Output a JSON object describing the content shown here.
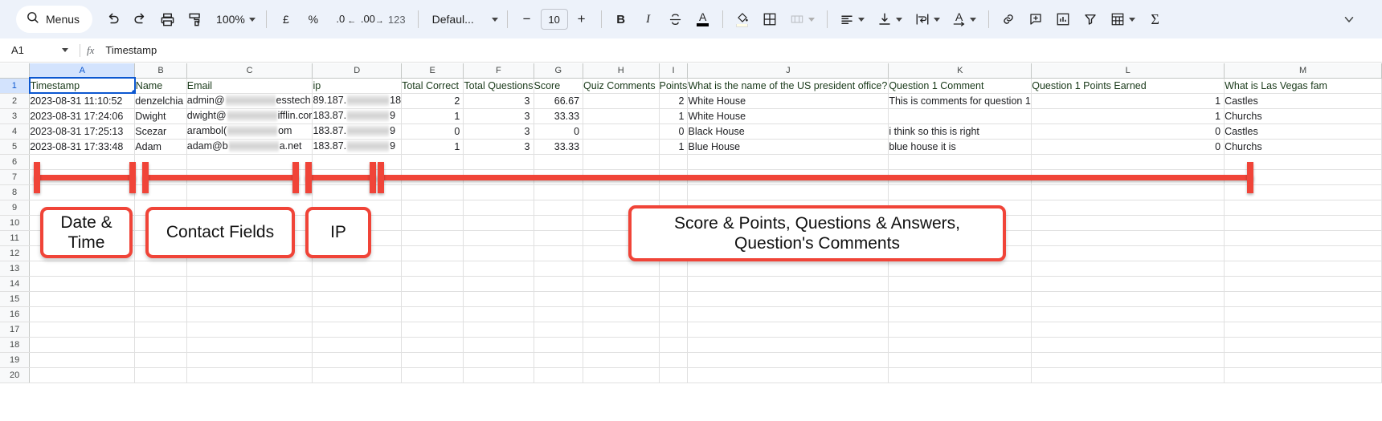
{
  "toolbar": {
    "search_label": "Menus",
    "search_icon": "search-icon",
    "undo_icon": "undo-icon",
    "redo_icon": "redo-icon",
    "print_icon": "print-icon",
    "paint_format_icon": "paint-format-icon",
    "zoom_value": "100%",
    "currency_label": "£",
    "percent_label": "%",
    "decrease_decimal_label": ".0",
    "increase_decimal_label": ".00",
    "more_formats_label": "123",
    "font_name": "Defaul...",
    "font_decrease_label": "−",
    "font_size_value": "10",
    "font_increase_label": "+",
    "bold_label": "B",
    "italic_label": "I",
    "strikethrough_icon": "strikethrough-icon",
    "text_color_label": "A",
    "fill_color_icon": "fill-color-icon",
    "borders_icon": "borders-icon",
    "merge_cells_icon": "merge-cells-icon",
    "horizontal_align_icon": "horizontal-align-icon",
    "vertical_align_icon": "vertical-align-icon",
    "text_wrap_icon": "text-wrap-icon",
    "text_rotation_label": "A",
    "link_icon": "link-icon",
    "comment_icon": "insert-comment-icon",
    "chart_icon": "insert-chart-icon",
    "filter_icon": "filter-icon",
    "functions_label": "Σ",
    "calculator_icon": "pivot-table-icon",
    "collapse_icon": "collapse-toolbar-icon"
  },
  "formula_bar": {
    "name_box": "A1",
    "fx_label": "fx",
    "content": "Timestamp"
  },
  "grid": {
    "column_letters": [
      "A",
      "B",
      "C",
      "D",
      "E",
      "F",
      "G",
      "H",
      "I",
      "J",
      "K",
      "L",
      "M"
    ],
    "selected_column": "A",
    "selected_row": "1",
    "row_numbers": [
      "1",
      "2",
      "3",
      "4",
      "5",
      "6",
      "7",
      "8",
      "9",
      "10",
      "11",
      "12",
      "13",
      "14",
      "15",
      "16",
      "17",
      "18",
      "19",
      "20"
    ],
    "headers": [
      "Timestamp",
      "Name",
      "Email",
      "ip",
      "Total Correct",
      "Total Questions",
      "Score",
      "Quiz Comments",
      "Points",
      "What is the name of the US president office?",
      "Question 1 Comment",
      "Question 1 Points Earned",
      "What is Las Vegas fam"
    ],
    "rows": [
      {
        "timestamp": "2023-08-31 11:10:52",
        "name": "denzelchia",
        "email_prefix": "admin@",
        "email_suffix": "esstech",
        "ip_prefix": "89.187.",
        "ip_suffix": "18",
        "total_correct": "2",
        "total_questions": "3",
        "score": "66.67",
        "quiz_comments": "",
        "points": "2",
        "q1_answer": "White House",
        "q1_comment": "This is comments for question 1",
        "q1_points": "1",
        "q2_answer": "Castles"
      },
      {
        "timestamp": "2023-08-31 17:24:06",
        "name": "Dwight",
        "email_prefix": "dwight@",
        "email_suffix": "ifflin.cor",
        "ip_prefix": "183.87.",
        "ip_suffix": "9",
        "total_correct": "1",
        "total_questions": "3",
        "score": "33.33",
        "quiz_comments": "",
        "points": "1",
        "q1_answer": "White House",
        "q1_comment": "",
        "q1_points": "1",
        "q2_answer": "Churchs"
      },
      {
        "timestamp": "2023-08-31 17:25:13",
        "name": "Scezar",
        "email_prefix": "arambol(",
        "email_suffix": "om",
        "ip_prefix": "183.87.",
        "ip_suffix": "9",
        "total_correct": "0",
        "total_questions": "3",
        "score": "0",
        "quiz_comments": "",
        "points": "0",
        "q1_answer": "Black House",
        "q1_comment": "i think so this is right",
        "q1_points": "0",
        "q2_answer": "Castles"
      },
      {
        "timestamp": "2023-08-31 17:33:48",
        "name": "Adam",
        "email_prefix": "adam@b",
        "email_suffix": "a.net",
        "ip_prefix": "183.87.",
        "ip_suffix": "9",
        "total_correct": "1",
        "total_questions": "3",
        "score": "33.33",
        "quiz_comments": "",
        "points": "1",
        "q1_answer": "Blue House",
        "q1_comment": "blue house it is",
        "q1_points": "0",
        "q2_answer": "Churchs"
      }
    ]
  },
  "annotations": {
    "accent_color": "#f04438",
    "callouts": [
      {
        "text": "Date & Time"
      },
      {
        "text": "Contact Fields"
      },
      {
        "text": "IP"
      },
      {
        "text": "Score & Points, Questions & Answers, Question's Comments"
      }
    ]
  }
}
